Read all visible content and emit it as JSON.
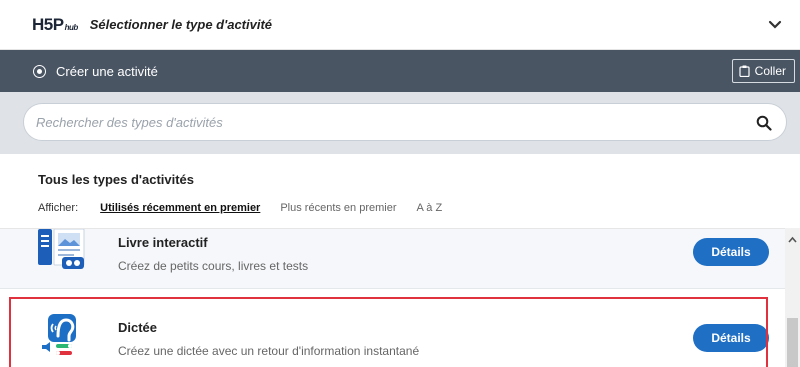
{
  "header": {
    "logo_main": "H5P",
    "logo_sub": "hub",
    "title": "Sélectionner le type d'activité"
  },
  "create_bar": {
    "label": "Créer une activité",
    "paste_label": "Coller"
  },
  "search": {
    "placeholder": "Rechercher des types d'activités",
    "value": ""
  },
  "section": {
    "title": "Tous les types d'activités",
    "sort_label": "Afficher:",
    "sort_options": [
      {
        "label": "Utilisés récemment en premier",
        "active": true
      },
      {
        "label": "Plus récents en premier",
        "active": false
      },
      {
        "label": "A à Z",
        "active": false
      }
    ]
  },
  "content_types": [
    {
      "title": "Livre interactif",
      "description": "Créez de petits cours, livres et tests",
      "button": "Détails",
      "icon": "interactive-book-icon"
    },
    {
      "title": "Dictée",
      "description": "Créez une dictée avec un retour d'information instantané",
      "button": "Détails",
      "icon": "dictation-icon"
    }
  ],
  "colors": {
    "accent": "#1f6fc5",
    "dark_bar": "#4a5564",
    "highlight": "#e0323e"
  }
}
